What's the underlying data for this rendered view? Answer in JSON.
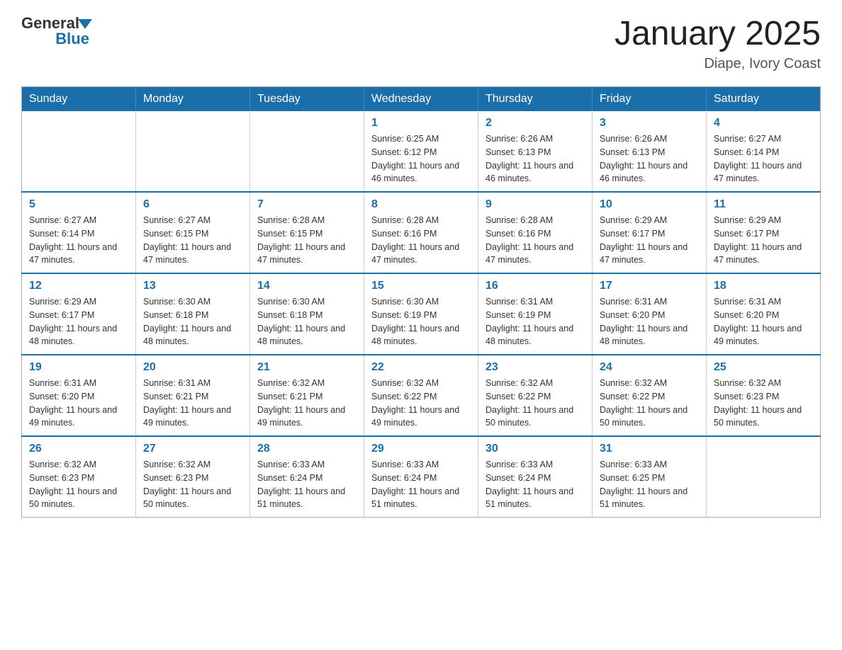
{
  "logo": {
    "general": "General",
    "blue": "Blue"
  },
  "title": "January 2025",
  "subtitle": "Diape, Ivory Coast",
  "weekdays": [
    "Sunday",
    "Monday",
    "Tuesday",
    "Wednesday",
    "Thursday",
    "Friday",
    "Saturday"
  ],
  "weeks": [
    [
      null,
      null,
      null,
      {
        "day": "1",
        "sunrise": "Sunrise: 6:25 AM",
        "sunset": "Sunset: 6:12 PM",
        "daylight": "Daylight: 11 hours and 46 minutes."
      },
      {
        "day": "2",
        "sunrise": "Sunrise: 6:26 AM",
        "sunset": "Sunset: 6:13 PM",
        "daylight": "Daylight: 11 hours and 46 minutes."
      },
      {
        "day": "3",
        "sunrise": "Sunrise: 6:26 AM",
        "sunset": "Sunset: 6:13 PM",
        "daylight": "Daylight: 11 hours and 46 minutes."
      },
      {
        "day": "4",
        "sunrise": "Sunrise: 6:27 AM",
        "sunset": "Sunset: 6:14 PM",
        "daylight": "Daylight: 11 hours and 47 minutes."
      }
    ],
    [
      {
        "day": "5",
        "sunrise": "Sunrise: 6:27 AM",
        "sunset": "Sunset: 6:14 PM",
        "daylight": "Daylight: 11 hours and 47 minutes."
      },
      {
        "day": "6",
        "sunrise": "Sunrise: 6:27 AM",
        "sunset": "Sunset: 6:15 PM",
        "daylight": "Daylight: 11 hours and 47 minutes."
      },
      {
        "day": "7",
        "sunrise": "Sunrise: 6:28 AM",
        "sunset": "Sunset: 6:15 PM",
        "daylight": "Daylight: 11 hours and 47 minutes."
      },
      {
        "day": "8",
        "sunrise": "Sunrise: 6:28 AM",
        "sunset": "Sunset: 6:16 PM",
        "daylight": "Daylight: 11 hours and 47 minutes."
      },
      {
        "day": "9",
        "sunrise": "Sunrise: 6:28 AM",
        "sunset": "Sunset: 6:16 PM",
        "daylight": "Daylight: 11 hours and 47 minutes."
      },
      {
        "day": "10",
        "sunrise": "Sunrise: 6:29 AM",
        "sunset": "Sunset: 6:17 PM",
        "daylight": "Daylight: 11 hours and 47 minutes."
      },
      {
        "day": "11",
        "sunrise": "Sunrise: 6:29 AM",
        "sunset": "Sunset: 6:17 PM",
        "daylight": "Daylight: 11 hours and 47 minutes."
      }
    ],
    [
      {
        "day": "12",
        "sunrise": "Sunrise: 6:29 AM",
        "sunset": "Sunset: 6:17 PM",
        "daylight": "Daylight: 11 hours and 48 minutes."
      },
      {
        "day": "13",
        "sunrise": "Sunrise: 6:30 AM",
        "sunset": "Sunset: 6:18 PM",
        "daylight": "Daylight: 11 hours and 48 minutes."
      },
      {
        "day": "14",
        "sunrise": "Sunrise: 6:30 AM",
        "sunset": "Sunset: 6:18 PM",
        "daylight": "Daylight: 11 hours and 48 minutes."
      },
      {
        "day": "15",
        "sunrise": "Sunrise: 6:30 AM",
        "sunset": "Sunset: 6:19 PM",
        "daylight": "Daylight: 11 hours and 48 minutes."
      },
      {
        "day": "16",
        "sunrise": "Sunrise: 6:31 AM",
        "sunset": "Sunset: 6:19 PM",
        "daylight": "Daylight: 11 hours and 48 minutes."
      },
      {
        "day": "17",
        "sunrise": "Sunrise: 6:31 AM",
        "sunset": "Sunset: 6:20 PM",
        "daylight": "Daylight: 11 hours and 48 minutes."
      },
      {
        "day": "18",
        "sunrise": "Sunrise: 6:31 AM",
        "sunset": "Sunset: 6:20 PM",
        "daylight": "Daylight: 11 hours and 49 minutes."
      }
    ],
    [
      {
        "day": "19",
        "sunrise": "Sunrise: 6:31 AM",
        "sunset": "Sunset: 6:20 PM",
        "daylight": "Daylight: 11 hours and 49 minutes."
      },
      {
        "day": "20",
        "sunrise": "Sunrise: 6:31 AM",
        "sunset": "Sunset: 6:21 PM",
        "daylight": "Daylight: 11 hours and 49 minutes."
      },
      {
        "day": "21",
        "sunrise": "Sunrise: 6:32 AM",
        "sunset": "Sunset: 6:21 PM",
        "daylight": "Daylight: 11 hours and 49 minutes."
      },
      {
        "day": "22",
        "sunrise": "Sunrise: 6:32 AM",
        "sunset": "Sunset: 6:22 PM",
        "daylight": "Daylight: 11 hours and 49 minutes."
      },
      {
        "day": "23",
        "sunrise": "Sunrise: 6:32 AM",
        "sunset": "Sunset: 6:22 PM",
        "daylight": "Daylight: 11 hours and 50 minutes."
      },
      {
        "day": "24",
        "sunrise": "Sunrise: 6:32 AM",
        "sunset": "Sunset: 6:22 PM",
        "daylight": "Daylight: 11 hours and 50 minutes."
      },
      {
        "day": "25",
        "sunrise": "Sunrise: 6:32 AM",
        "sunset": "Sunset: 6:23 PM",
        "daylight": "Daylight: 11 hours and 50 minutes."
      }
    ],
    [
      {
        "day": "26",
        "sunrise": "Sunrise: 6:32 AM",
        "sunset": "Sunset: 6:23 PM",
        "daylight": "Daylight: 11 hours and 50 minutes."
      },
      {
        "day": "27",
        "sunrise": "Sunrise: 6:32 AM",
        "sunset": "Sunset: 6:23 PM",
        "daylight": "Daylight: 11 hours and 50 minutes."
      },
      {
        "day": "28",
        "sunrise": "Sunrise: 6:33 AM",
        "sunset": "Sunset: 6:24 PM",
        "daylight": "Daylight: 11 hours and 51 minutes."
      },
      {
        "day": "29",
        "sunrise": "Sunrise: 6:33 AM",
        "sunset": "Sunset: 6:24 PM",
        "daylight": "Daylight: 11 hours and 51 minutes."
      },
      {
        "day": "30",
        "sunrise": "Sunrise: 6:33 AM",
        "sunset": "Sunset: 6:24 PM",
        "daylight": "Daylight: 11 hours and 51 minutes."
      },
      {
        "day": "31",
        "sunrise": "Sunrise: 6:33 AM",
        "sunset": "Sunset: 6:25 PM",
        "daylight": "Daylight: 11 hours and 51 minutes."
      },
      null
    ]
  ]
}
